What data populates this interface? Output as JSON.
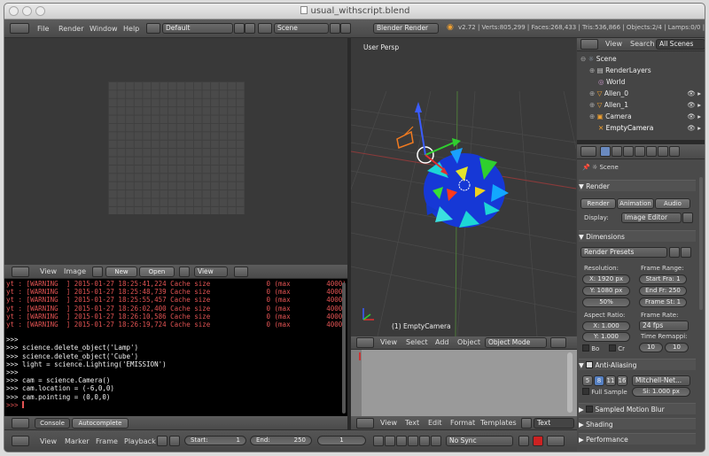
{
  "window": {
    "title": "usual_withscript.blend"
  },
  "info_header": {
    "menus": [
      "File",
      "Render",
      "Window",
      "Help"
    ],
    "layout": "Default",
    "scene": "Scene",
    "engine": "Blender Render",
    "stats": "v2.72 | Verts:805,299 | Faces:268,433 | Tris:536,866 | Objects:2/4 | Lamps:0/0 | Me"
  },
  "viewport": {
    "label": "User Persp",
    "object_label": "(1) EmptyCamera"
  },
  "image_editor": {
    "menus": [
      "View",
      "Image"
    ],
    "new_label": "New",
    "open_label": "Open",
    "view_label": "View"
  },
  "console": {
    "log_lines": [
      "yt : [WARNING  ] 2015-01-27 18:25:41,224 Cache size              0 (max         4000)",
      "yt : [WARNING  ] 2015-01-27 18:25:48,739 Cache size              0 (max         4000)",
      "yt : [WARNING  ] 2015-01-27 18:25:55,457 Cache size              0 (max         4000)",
      "yt : [WARNING  ] 2015-01-27 18:26:02,400 Cache size              0 (max         4000)",
      "yt : [WARNING  ] 2015-01-27 18:26:10,586 Cache size              0 (max         4000)",
      "yt : [WARNING  ] 2015-01-27 18:26:19,724 Cache size              0 (max         4000)"
    ],
    "code_lines": [
      ">>>",
      ">>> science.delete_object('Lamp')",
      ">>> science.delete_object('Cube')",
      ">>> light = science.Lighting('EMISSION')",
      ">>>",
      ">>> cam = science.Camera()",
      ">>> cam.location = (-6,0,0)",
      ">>> cam.pointing = (0,0,0)",
      ">>> "
    ],
    "tabs": [
      "Console",
      "Autocomplete"
    ]
  },
  "view3d_header": {
    "menus": [
      "View",
      "Select",
      "Add",
      "Object"
    ],
    "mode": "Object Mode"
  },
  "text_header": {
    "menus": [
      "View",
      "Text",
      "Edit",
      "Format",
      "Templates"
    ],
    "text_label": "Text"
  },
  "timeline": {
    "menus": [
      "View",
      "Marker",
      "Frame",
      "Playback"
    ],
    "start": "Start:",
    "start_val": "1",
    "end": "End:",
    "end_val": "250",
    "current": "1",
    "sync": "No Sync"
  },
  "outliner": {
    "tabs": [
      "View",
      "Search",
      "All Scenes"
    ],
    "items": [
      "Scene",
      "RenderLayers",
      "World",
      "Allen_0",
      "Allen_1",
      "Camera",
      "EmptyCamera"
    ]
  },
  "properties": {
    "breadcrumb": "Scene",
    "render": {
      "title": "Render",
      "render_btn": "Render",
      "anim_btn": "Animation",
      "audio_btn": "Audio",
      "display_label": "Display:",
      "display_val": "Image Editor"
    },
    "dimensions": {
      "title": "Dimensions",
      "presets": "Render Presets",
      "resolution": "Resolution:",
      "x": "X:",
      "x_val": "1920 px",
      "y": "Y:",
      "y_val": "1080 px",
      "pct": "50%",
      "frame_range": "Frame Range:",
      "start": "Start Fra:",
      "start_val": "1",
      "end": "End Fr:",
      "end_val": "250",
      "step": "Frame St:",
      "step_val": "1",
      "aspect": "Aspect Ratio:",
      "ax": "X:",
      "ax_val": "1.000",
      "ay": "Y:",
      "ay_val": "1.000",
      "frame_rate": "Frame Rate:",
      "fps": "24 fps",
      "time_remap": "Time Remappi:",
      "remap_a": "10",
      "remap_b": "10",
      "bo": "Bo",
      "cr": "Cr"
    },
    "aa": {
      "title": "Anti-Aliasing",
      "samples": [
        "5",
        "8",
        "11",
        "16"
      ],
      "filter": "Mitchell-Net...",
      "full_sample": "Full Sample",
      "size": "Si: 1.000 px"
    },
    "sections": [
      "Sampled Motion Blur",
      "Shading",
      "Performance"
    ]
  }
}
